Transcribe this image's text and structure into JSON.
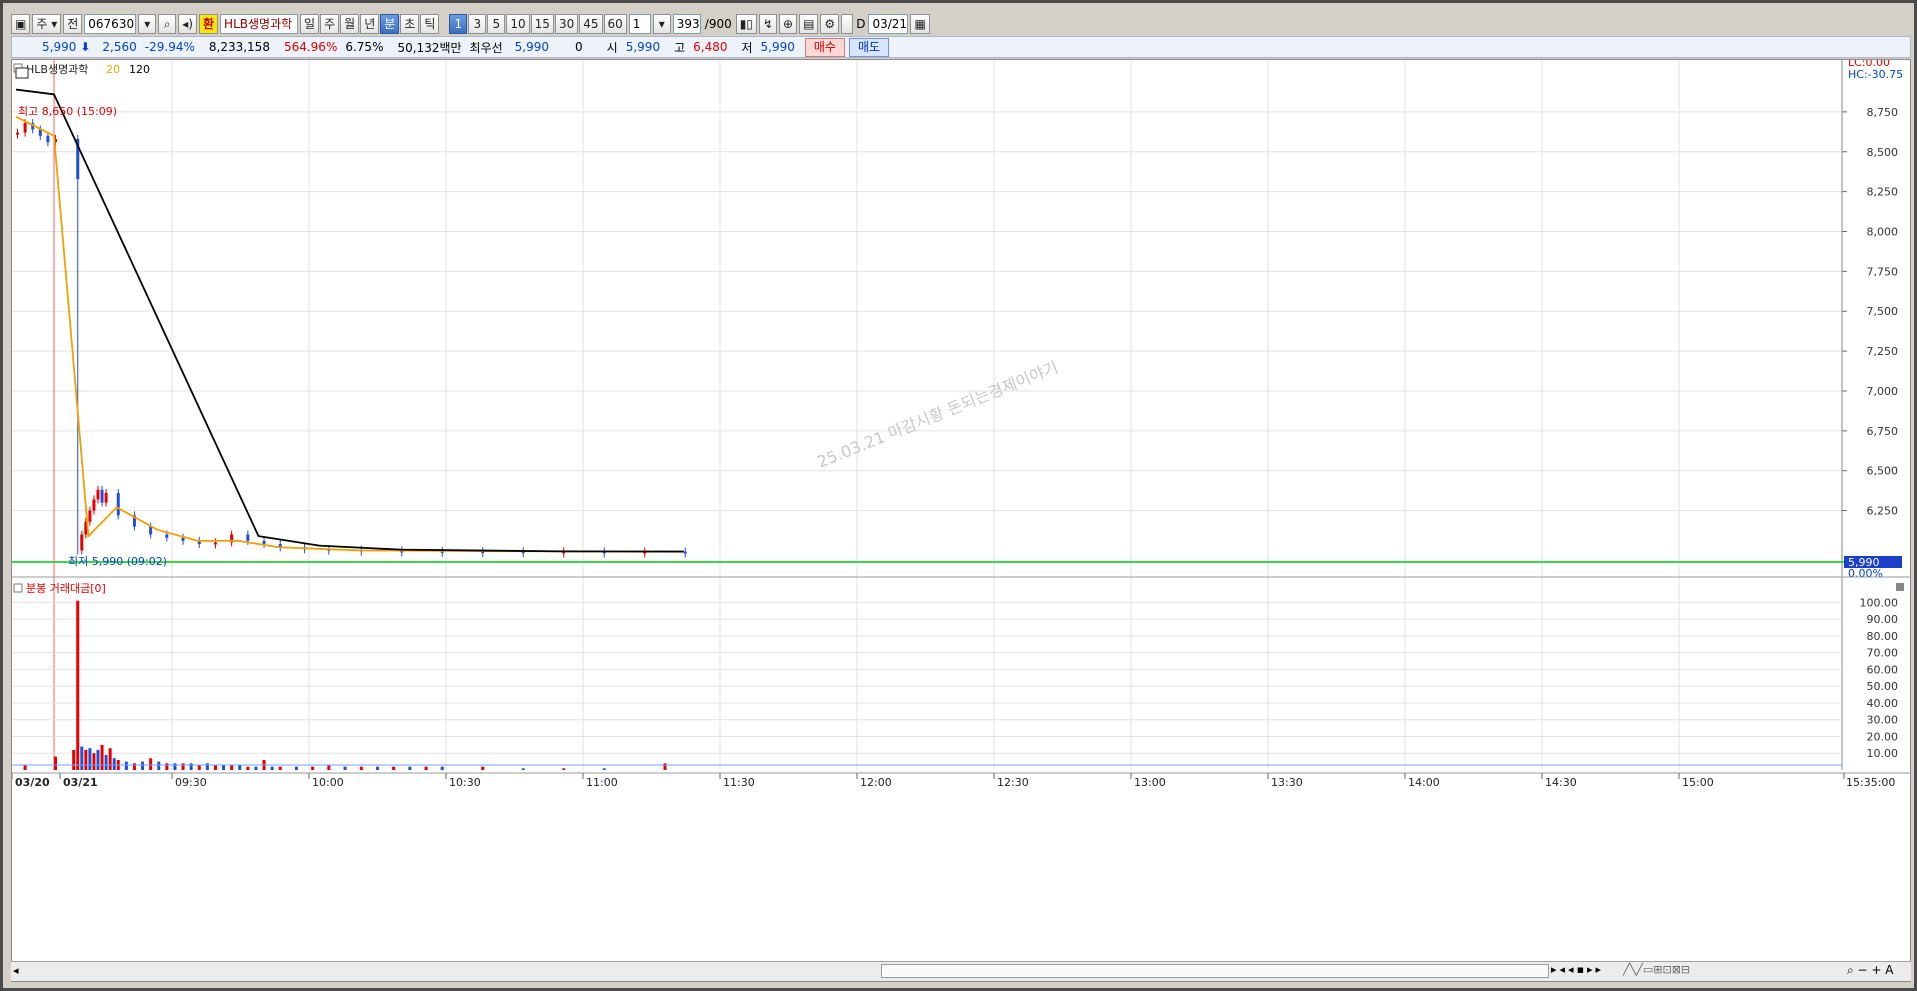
{
  "toolbar": {
    "mode_label": "주",
    "prev_label": "전",
    "code_value": "067630",
    "hwan_label": "환",
    "stock_name": "HLB생명과학",
    "periods": [
      "일",
      "주",
      "월",
      "년",
      "분",
      "초",
      "틱"
    ],
    "active_period": "분",
    "intervals": [
      "1",
      "3",
      "5",
      "10",
      "15",
      "30",
      "45",
      "60"
    ],
    "active_interval": "1",
    "interval_select": "1",
    "count_value": "393",
    "count_max": "/900",
    "d_label": "D",
    "date_value": "03/21"
  },
  "quote": {
    "price": "5,990",
    "change": "2,560",
    "change_pct": "-29.94%",
    "volume": "8,233,158",
    "vol_ratio": "564.96%",
    "turnover": "6.75%",
    "amount": "50,132백만",
    "priority_label": "최우선",
    "priority_price": "5,990",
    "priority_qty": "0",
    "open_label": "시",
    "open": "5,990",
    "high_label": "고",
    "high": "6,480",
    "low_label": "저",
    "low": "5,990",
    "buy_label": "매수",
    "sell_label": "매도"
  },
  "price_panel": {
    "legend_name": "HLB생명과학",
    "legend_ma1": "20",
    "legend_ma2": "120",
    "lc_label": "LC:0.00",
    "hc_label": "HC:-30.75",
    "high_marker": "최고 8,650 (15:09)",
    "low_marker": "최저 5,990 (09:02)",
    "last_price_tag": "5,990",
    "last_pct_tag": "0.00%",
    "watermark": "25.03.21 마감시황 돈되는경제이야기"
  },
  "volume_panel": {
    "title": "분봉 거래대금[0]"
  },
  "x_labels": [
    "03/20",
    "03/21",
    "09:30",
    "10:00",
    "10:30",
    "11:00",
    "11:30",
    "12:00",
    "12:30",
    "13:00",
    "13:30",
    "14:00",
    "14:30",
    "15:00",
    "15:35:00"
  ],
  "colors": {
    "up": "#e60000",
    "down": "#1f4fd6",
    "ma20": "#f0a000",
    "ma120": "#000000",
    "baseline": "#00cc00",
    "grid": "#e2e2e2",
    "tag_bg": "#1a3fc8"
  },
  "chart_data": [
    {
      "type": "candlestick",
      "title": "HLB생명과학",
      "x": [
        "03/20",
        "03/21 09:00",
        "09:30",
        "10:00",
        "10:30",
        "11:00",
        "11:30",
        "12:00",
        "12:30",
        "13:00",
        "13:30",
        "14:00",
        "14:30",
        "15:00",
        "15:35:00"
      ],
      "y_ticks": [
        6250,
        6500,
        6750,
        7000,
        7250,
        7500,
        7750,
        8000,
        8250,
        8500,
        8750
      ],
      "ylim": [
        5940,
        8950
      ],
      "price_path": [
        [
          0,
          8620
        ],
        [
          1,
          8680
        ],
        [
          2,
          8640
        ],
        [
          3,
          8600
        ],
        [
          4,
          8560
        ],
        [
          5,
          8580
        ],
        [
          10,
          6000
        ],
        [
          11,
          6100
        ],
        [
          12,
          6180
        ],
        [
          13,
          6250
        ],
        [
          14,
          6320
        ],
        [
          15,
          6380
        ],
        [
          16,
          6300
        ],
        [
          17,
          6360
        ],
        [
          20,
          6220
        ],
        [
          24,
          6150
        ],
        [
          28,
          6100
        ],
        [
          32,
          6080
        ],
        [
          36,
          6060
        ],
        [
          40,
          6040
        ],
        [
          44,
          6050
        ],
        [
          48,
          6100
        ],
        [
          52,
          6060
        ],
        [
          56,
          6040
        ],
        [
          60,
          6020
        ],
        [
          66,
          6010
        ],
        [
          72,
          6005
        ],
        [
          80,
          6000
        ],
        [
          90,
          5998
        ],
        [
          100,
          5996
        ],
        [
          110,
          5995
        ],
        [
          120,
          5994
        ],
        [
          130,
          5994
        ],
        [
          140,
          5993
        ],
        [
          150,
          5993
        ],
        [
          160,
          5992
        ]
      ],
      "series": [
        {
          "name": "20",
          "values": [
            [
              0,
              8720
            ],
            [
              5,
              8600
            ],
            [
              13,
              6090
            ],
            [
              20,
              6270
            ],
            [
              30,
              6130
            ],
            [
              40,
              6060
            ],
            [
              50,
              6060
            ],
            [
              60,
              6020
            ],
            [
              80,
              6000
            ],
            [
              120,
              5995
            ],
            [
              160,
              5993
            ]
          ]
        },
        {
          "name": "120",
          "values": [
            [
              0,
              8890
            ],
            [
              5,
              8860
            ],
            [
              55,
              6090
            ],
            [
              70,
              6030
            ],
            [
              90,
              6005
            ],
            [
              130,
              5994
            ],
            [
              160,
              5993
            ]
          ]
        }
      ],
      "annotations": [
        "최고 8,650 (15:09)",
        "최저 5,990 (09:02)"
      ],
      "last": 5990
    },
    {
      "type": "bar",
      "title": "분봉 거래대금[0]",
      "y_ticks": [
        10,
        20,
        30,
        40,
        50,
        60,
        70,
        80,
        90,
        100
      ],
      "ylim": [
        0,
        105
      ],
      "bars": [
        [
          1,
          3,
          "up"
        ],
        [
          5,
          8,
          "up"
        ],
        [
          9,
          12,
          "up"
        ],
        [
          10,
          101,
          "up"
        ],
        [
          11,
          14,
          "down"
        ],
        [
          12,
          12,
          "up"
        ],
        [
          13,
          13,
          "down"
        ],
        [
          14,
          10,
          "up"
        ],
        [
          15,
          12,
          "down"
        ],
        [
          16,
          15,
          "up"
        ],
        [
          17,
          9,
          "down"
        ],
        [
          18,
          13,
          "up"
        ],
        [
          19,
          7,
          "down"
        ],
        [
          20,
          6,
          "up"
        ],
        [
          22,
          5,
          "down"
        ],
        [
          24,
          4,
          "up"
        ],
        [
          26,
          5,
          "down"
        ],
        [
          28,
          7,
          "up"
        ],
        [
          30,
          5,
          "down"
        ],
        [
          32,
          4,
          "up"
        ],
        [
          34,
          4,
          "down"
        ],
        [
          36,
          4,
          "up"
        ],
        [
          38,
          4,
          "down"
        ],
        [
          40,
          3,
          "up"
        ],
        [
          42,
          4,
          "down"
        ],
        [
          44,
          3,
          "up"
        ],
        [
          46,
          3,
          "down"
        ],
        [
          48,
          3,
          "up"
        ],
        [
          50,
          3,
          "down"
        ],
        [
          52,
          2,
          "up"
        ],
        [
          54,
          2,
          "down"
        ],
        [
          56,
          6,
          "up"
        ],
        [
          58,
          2,
          "down"
        ],
        [
          60,
          2,
          "up"
        ],
        [
          64,
          2,
          "down"
        ],
        [
          68,
          2,
          "up"
        ],
        [
          72,
          3,
          "up"
        ],
        [
          76,
          2,
          "down"
        ],
        [
          80,
          2,
          "up"
        ],
        [
          84,
          2,
          "down"
        ],
        [
          88,
          2,
          "up"
        ],
        [
          92,
          2,
          "down"
        ],
        [
          96,
          2,
          "up"
        ],
        [
          100,
          2,
          "down"
        ],
        [
          110,
          2,
          "up"
        ],
        [
          120,
          1,
          "down"
        ],
        [
          130,
          1,
          "up"
        ],
        [
          140,
          1,
          "down"
        ],
        [
          155,
          4,
          "up"
        ]
      ]
    }
  ]
}
